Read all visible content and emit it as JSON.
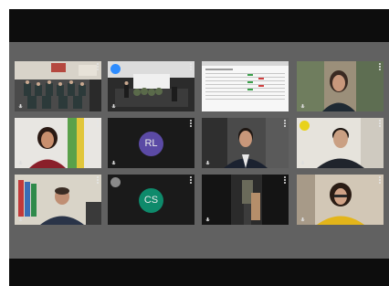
{
  "meeting": {
    "tiles": [
      {
        "id": "t1",
        "type": "video",
        "scene": "auditorium"
      },
      {
        "id": "t2",
        "type": "video",
        "scene": "presenter",
        "active": true
      },
      {
        "id": "t3",
        "type": "share",
        "scene": "document"
      },
      {
        "id": "t4",
        "type": "video",
        "scene": "woman-room"
      },
      {
        "id": "t5",
        "type": "video",
        "scene": "woman-flag"
      },
      {
        "id": "t6",
        "type": "avatar",
        "initials": "RL",
        "avatar_color": "#5b4aa5"
      },
      {
        "id": "t7",
        "type": "video",
        "scene": "man-suit"
      },
      {
        "id": "t8",
        "type": "video",
        "scene": "man-office"
      },
      {
        "id": "t9",
        "type": "video",
        "scene": "man-flags"
      },
      {
        "id": "t10",
        "type": "avatar",
        "initials": "CS",
        "avatar_color": "#0e8a6b"
      },
      {
        "id": "t11",
        "type": "video",
        "scene": "hallway"
      },
      {
        "id": "t12",
        "type": "video",
        "scene": "woman-yellow"
      }
    ]
  },
  "colors": {
    "stage_bg": "#616161",
    "tile_bg": "#1e1e1e",
    "active_border": "#2d8cff",
    "letterbox": "#0d0d0d"
  },
  "icons": {
    "mic": "microphone-icon",
    "more": "more-options-icon"
  }
}
